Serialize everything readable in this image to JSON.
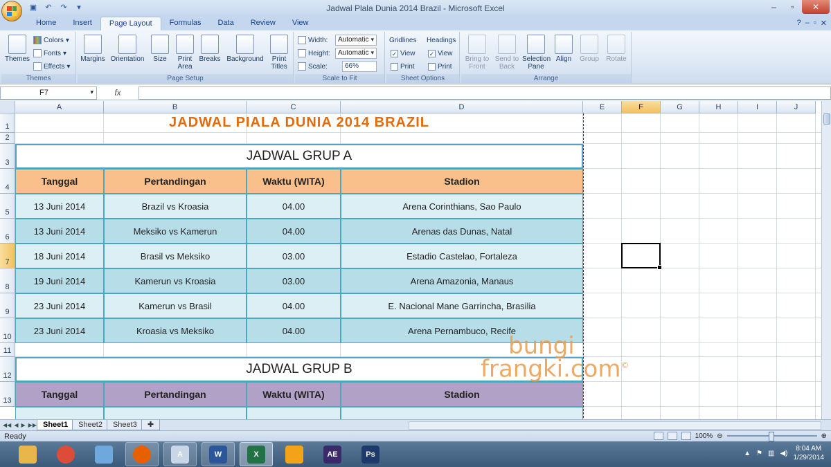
{
  "window": {
    "title": "Jadwal Plala Dunia 2014 Brazil - Microsoft Excel"
  },
  "tabs": [
    "Home",
    "Insert",
    "Page Layout",
    "Formulas",
    "Data",
    "Review",
    "View"
  ],
  "active_tab": "Page Layout",
  "ribbon": {
    "themes": {
      "label": "Themes",
      "button": "Themes",
      "colors": "Colors",
      "fonts": "Fonts",
      "effects": "Effects"
    },
    "page_setup": {
      "label": "Page Setup",
      "margins": "Margins",
      "orientation": "Orientation",
      "size": "Size",
      "print_area": "Print Area",
      "breaks": "Breaks",
      "background": "Background",
      "print_titles": "Print Titles"
    },
    "scale_to_fit": {
      "label": "Scale to Fit",
      "width_label": "Width:",
      "width_value": "Automatic",
      "height_label": "Height:",
      "height_value": "Automatic",
      "scale_label": "Scale:",
      "scale_value": "66%"
    },
    "sheet_options": {
      "label": "Sheet Options",
      "gridlines": "Gridlines",
      "headings": "Headings",
      "view": "View",
      "print": "Print",
      "gridlines_view": true,
      "gridlines_print": false,
      "headings_view": true,
      "headings_print": false
    },
    "arrange": {
      "label": "Arrange",
      "bring_to_front": "Bring to Front",
      "send_to_back": "Send to Back",
      "selection_pane": "Selection Pane",
      "align": "Align",
      "group": "Group",
      "rotate": "Rotate"
    }
  },
  "formula_bar": {
    "name_box": "F7",
    "fx": "fx",
    "content": ""
  },
  "columns": [
    "A",
    "B",
    "C",
    "D",
    "E",
    "F",
    "G",
    "H",
    "I",
    "J"
  ],
  "selected_column": "F",
  "rows": [
    "1",
    "2",
    "3",
    "4",
    "5",
    "6",
    "7",
    "8",
    "9",
    "10",
    "11",
    "12",
    "13"
  ],
  "selected_row": "7",
  "sheet": {
    "title": "JADWAL PIALA DUNIA 2014 BRAZIL",
    "group_a": {
      "title": "JADWAL GRUP A",
      "headers": [
        "Tanggal",
        "Pertandingan",
        "Waktu (WITA)",
        "Stadion"
      ],
      "rows": [
        [
          "13 Juni 2014",
          "Brazil vs Kroasia",
          "04.00",
          "Arena Corinthians, Sao Paulo"
        ],
        [
          "13 Juni 2014",
          "Meksiko vs Kamerun",
          "04.00",
          "Arenas das Dunas, Natal"
        ],
        [
          "18 Juni 2014",
          "Brasil vs Meksiko",
          "03.00",
          "Estadio Castelao, Fortaleza"
        ],
        [
          "19 Juni 2014",
          "Kamerun vs Kroasia",
          "03.00",
          "Arena Amazonia, Manaus"
        ],
        [
          "23 Juni 2014",
          "Kamerun vs Brasil",
          "04.00",
          "E. Nacional Mane Garrincha, Brasilia"
        ],
        [
          "23 Juni 2014",
          "Kroasia vs Meksiko",
          "04.00",
          "Arena Pernambuco, Recife"
        ]
      ]
    },
    "group_b": {
      "title": "JADWAL GRUP B",
      "headers": [
        "Tanggal",
        "Pertandingan",
        "Waktu (WITA)",
        "Stadion"
      ]
    }
  },
  "watermark": {
    "line1": "bungi",
    "line2": "frangki.com",
    "mark": "©"
  },
  "sheet_tabs": [
    "Sheet1",
    "Sheet2",
    "Sheet3"
  ],
  "active_sheet": "Sheet1",
  "status": {
    "text": "Ready",
    "zoom": "100%"
  },
  "taskbar": {
    "apps": [
      {
        "name": "file-explorer-icon",
        "label": "",
        "color": "#e8b64a"
      },
      {
        "name": "chrome-icon",
        "label": "",
        "color": "#dd4b39"
      },
      {
        "name": "notes-icon",
        "label": "",
        "color": "#6fa8dc"
      },
      {
        "name": "firefox-icon",
        "label": "",
        "color": "#e66000"
      },
      {
        "name": "notepad-icon",
        "label": "A",
        "color": "#c9d6e6"
      },
      {
        "name": "word-icon",
        "label": "W",
        "color": "#2b579a"
      },
      {
        "name": "excel-icon",
        "label": "X",
        "color": "#217346"
      },
      {
        "name": "ribbon-app-icon",
        "label": "",
        "color": "#f4a21a"
      },
      {
        "name": "after-effects-icon",
        "label": "AE",
        "color": "#3a2a6a"
      },
      {
        "name": "photoshop-icon",
        "label": "Ps",
        "color": "#1e3a6a"
      }
    ],
    "time": "8:04 AM",
    "date": "1/29/2014"
  }
}
